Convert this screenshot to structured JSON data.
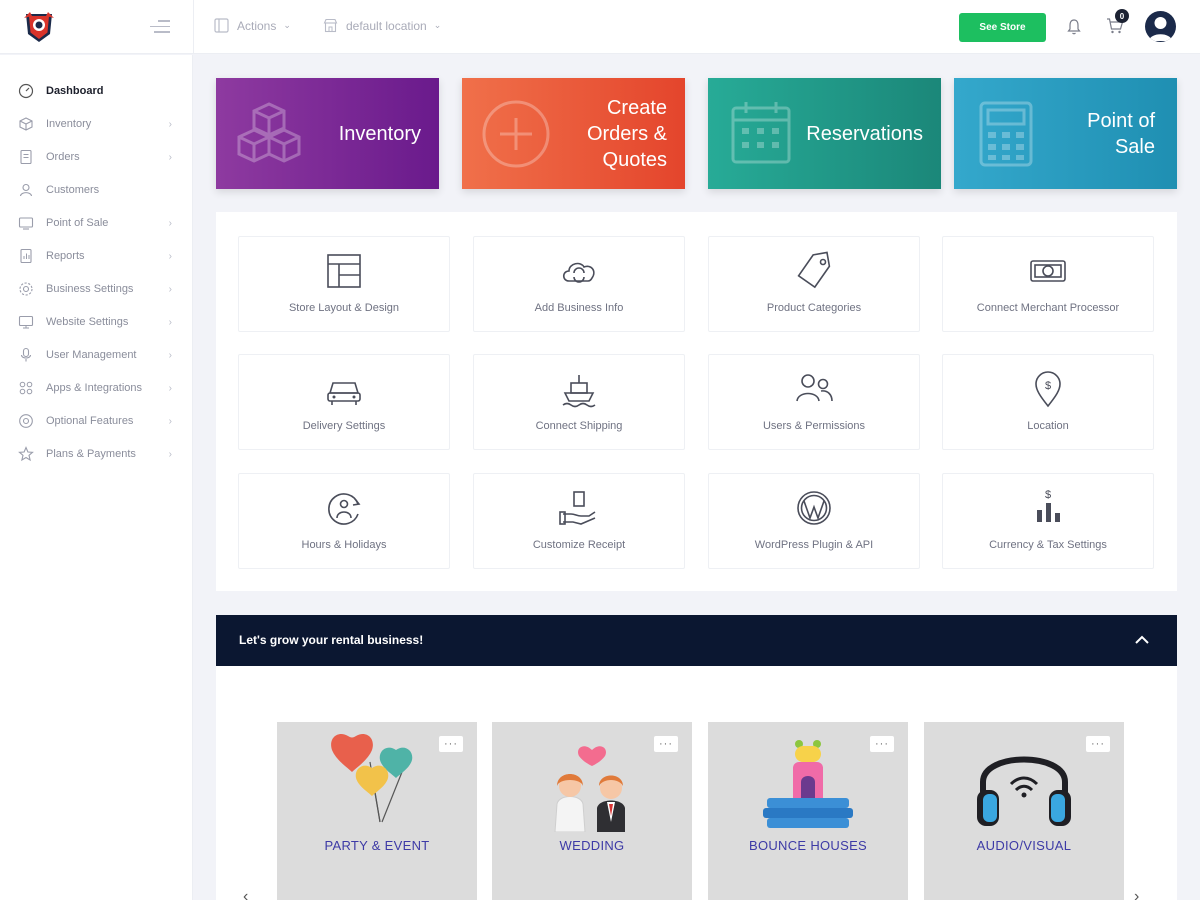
{
  "topbar": {
    "actions_label": "Actions",
    "location_label": "default location",
    "see_store_label": "See Store",
    "cart_count": "0"
  },
  "sidebar": {
    "items": [
      {
        "label": "Dashboard",
        "icon": "dashboard-icon",
        "active": true,
        "has_submenu": false
      },
      {
        "label": "Inventory",
        "icon": "inventory-icon",
        "active": false,
        "has_submenu": true
      },
      {
        "label": "Orders",
        "icon": "orders-icon",
        "active": false,
        "has_submenu": true
      },
      {
        "label": "Customers",
        "icon": "customers-icon",
        "active": false,
        "has_submenu": false
      },
      {
        "label": "Point of Sale",
        "icon": "pos-icon",
        "active": false,
        "has_submenu": true
      },
      {
        "label": "Reports",
        "icon": "reports-icon",
        "active": false,
        "has_submenu": true
      },
      {
        "label": "Business Settings",
        "icon": "gear-icon",
        "active": false,
        "has_submenu": true
      },
      {
        "label": "Website Settings",
        "icon": "monitor-icon",
        "active": false,
        "has_submenu": true
      },
      {
        "label": "User Management",
        "icon": "user-icon",
        "active": false,
        "has_submenu": true
      },
      {
        "label": "Apps & Integrations",
        "icon": "apps-icon",
        "active": false,
        "has_submenu": true
      },
      {
        "label": "Optional Features",
        "icon": "features-icon",
        "active": false,
        "has_submenu": true
      },
      {
        "label": "Plans & Payments",
        "icon": "star-icon",
        "active": false,
        "has_submenu": true
      }
    ]
  },
  "hero_tiles": [
    {
      "label": "Inventory",
      "icon": "cubes-icon",
      "color": "#7b2a9e"
    },
    {
      "label": "Create Orders & Quotes",
      "label_lines": [
        "Create",
        "Orders &",
        "Quotes"
      ],
      "icon": "plus-circle-icon",
      "color": "#ec5a3a"
    },
    {
      "label": "Reservations",
      "icon": "calendar-icon",
      "color": "#1f9c8a"
    },
    {
      "label": "Point of Sale",
      "label_lines": [
        "Point of",
        "Sale"
      ],
      "icon": "calculator-icon",
      "color": "#2399b9"
    }
  ],
  "quick_settings": [
    {
      "label": "Store Layout & Design",
      "icon": "layout-icon"
    },
    {
      "label": "Add Business Info",
      "icon": "cloud-sync-icon"
    },
    {
      "label": "Product Categories",
      "icon": "tag-icon"
    },
    {
      "label": "Connect Merchant Processor",
      "icon": "cash-icon"
    },
    {
      "label": "Delivery Settings",
      "icon": "car-icon"
    },
    {
      "label": "Connect Shipping",
      "icon": "ship-icon"
    },
    {
      "label": "Users & Permissions",
      "icon": "users-icon"
    },
    {
      "label": "Location",
      "icon": "location-pin-icon"
    },
    {
      "label": "Hours & Holidays",
      "icon": "clock-person-icon"
    },
    {
      "label": "Customize Receipt",
      "icon": "receipt-hand-icon"
    },
    {
      "label": "WordPress Plugin & API",
      "icon": "wordpress-icon"
    },
    {
      "label": "Currency & Tax Settings",
      "icon": "currency-chart-icon"
    }
  ],
  "grow": {
    "title": "Let's grow your rental business!",
    "categories": [
      {
        "label": "PARTY & EVENT",
        "icon": "balloons-icon",
        "menu": "···"
      },
      {
        "label": "WEDDING",
        "icon": "couple-icon",
        "menu": "···"
      },
      {
        "label": "BOUNCE HOUSES",
        "icon": "bounce-house-icon",
        "menu": "···"
      },
      {
        "label": "AUDIO/VISUAL",
        "icon": "headphones-icon",
        "menu": "···"
      }
    ]
  }
}
